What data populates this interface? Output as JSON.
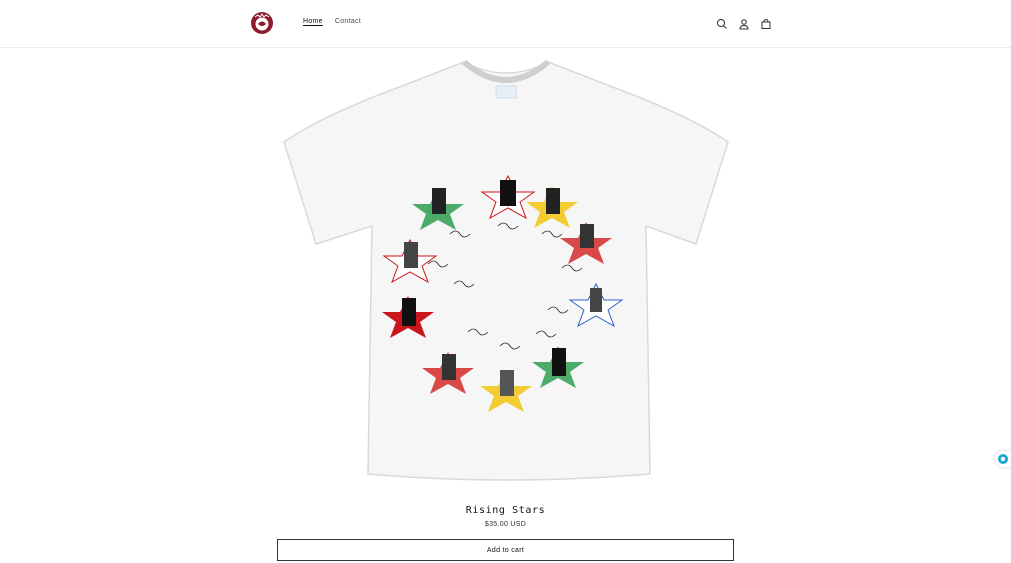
{
  "header": {
    "logo_icon": "brand-logo-icon",
    "nav": [
      {
        "label": "Home",
        "active": true
      },
      {
        "label": "Contact",
        "active": false
      }
    ],
    "icons": [
      "search-icon",
      "account-icon",
      "cart-icon"
    ]
  },
  "product": {
    "title": "Rising Stars",
    "price": "$35.00 USD",
    "add_to_cart_label": "Add to cart",
    "image_icon": "tshirt-product-image"
  },
  "colors": {
    "brand": "#8a1c2b",
    "button_border": "#333333",
    "chat_accent": "#1aa3d6"
  },
  "widgets": {
    "chat_icon": "chat-widget-icon"
  }
}
